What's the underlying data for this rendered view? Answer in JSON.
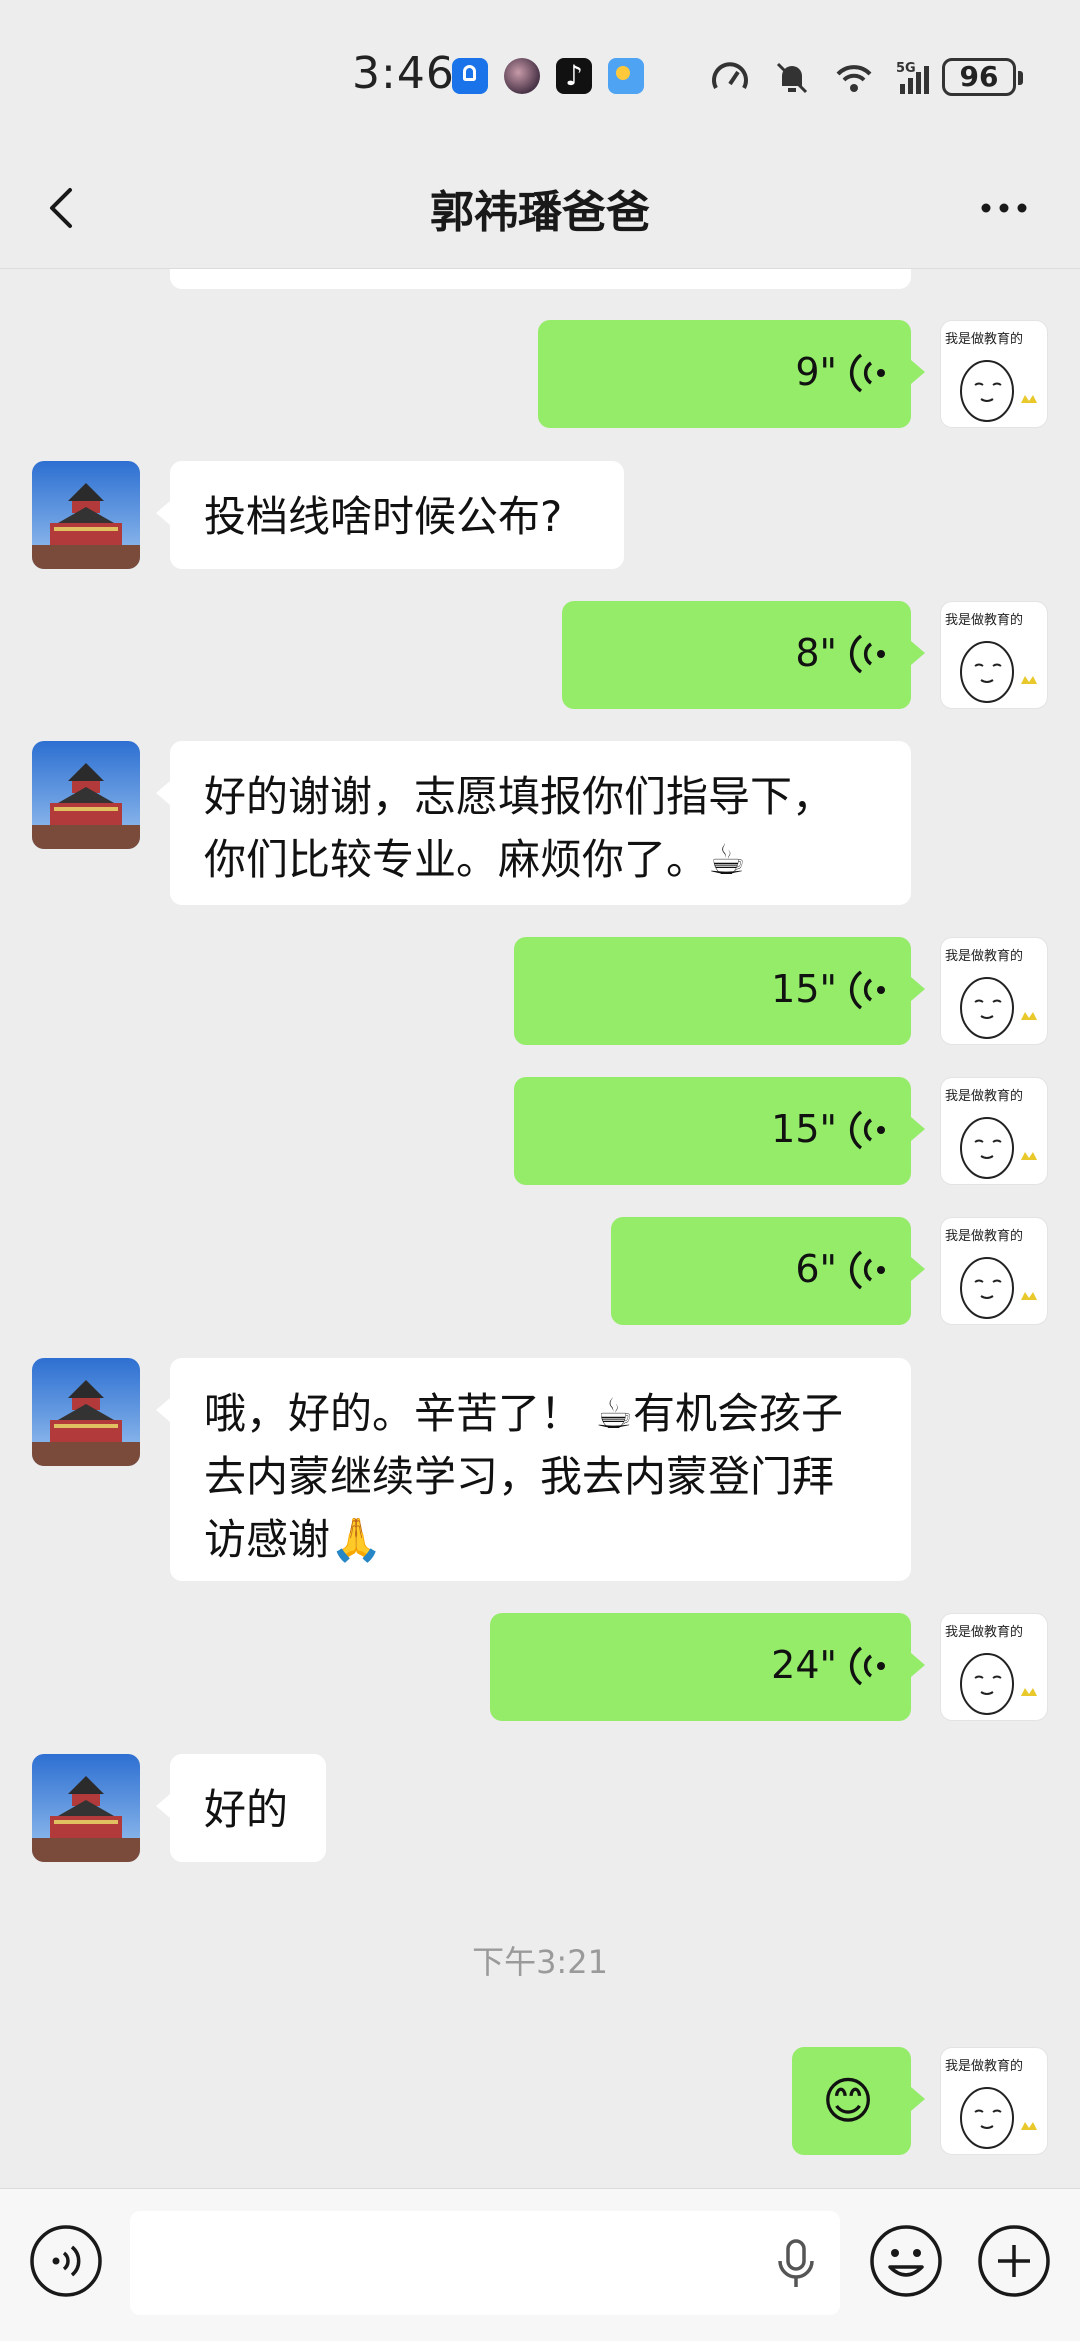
{
  "status_bar": {
    "time": "3:46",
    "battery": "96",
    "icons": [
      "lightbulb-app-icon",
      "avatar-app-icon",
      "tiktok-icon",
      "weather-icon",
      "speedometer-icon",
      "bell-muted-icon",
      "wifi-icon",
      "5g-signal-icon",
      "battery-icon"
    ]
  },
  "nav": {
    "title": "郭祎璠爸爸",
    "back_icon": "chevron-left-icon",
    "more_icon": "more-dots-icon"
  },
  "messages": [
    {
      "type": "voice",
      "duration": "9\""
    },
    {
      "type": "text",
      "text": "投档线啥时候公布?"
    },
    {
      "type": "voice",
      "duration": "8\""
    },
    {
      "type": "text",
      "lines": [
        "好的谢谢，志愿填报你们指导下，",
        "你们比较专业。麻烦你了。☕"
      ]
    },
    {
      "type": "voice",
      "duration": "15\""
    },
    {
      "type": "voice",
      "duration": "15\""
    },
    {
      "type": "voice",
      "duration": "6\""
    },
    {
      "type": "text",
      "lines": [
        "哦，好的。辛苦了！ ☕有机会孩子",
        "去内蒙继续学习，我去内蒙登门拜",
        "访感谢🙏"
      ]
    },
    {
      "type": "voice",
      "duration": "24\""
    },
    {
      "type": "text",
      "text": "好的"
    },
    {
      "type": "emoji",
      "text": "😊"
    }
  ],
  "timestamp": "下午3:21",
  "sticker_avatar_text": "我是做教育的",
  "colors": {
    "outgoing_bubble": "#95ec69",
    "incoming_bubble": "#ffffff",
    "background": "#ededed"
  },
  "input_bar": {
    "voice_toggle_icon": "voice-mode-icon",
    "mic_icon": "microphone-icon",
    "emoji_icon": "emoji-icon",
    "plus_icon": "plus-icon"
  }
}
